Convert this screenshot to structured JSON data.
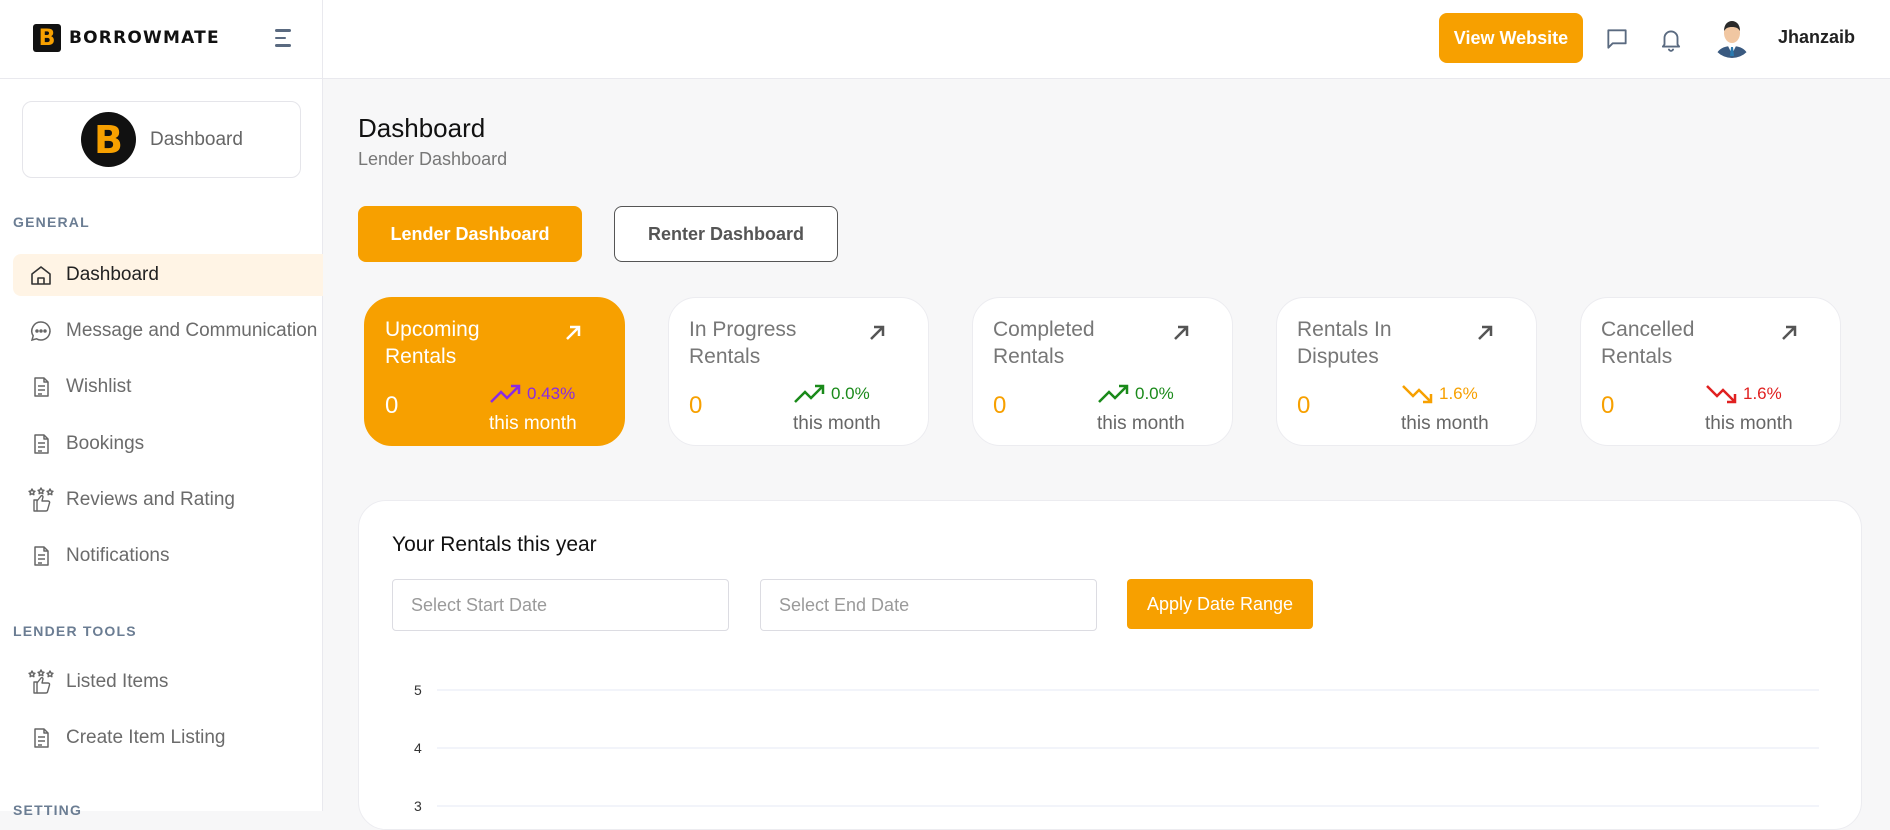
{
  "brand": {
    "name": "BORROWMATE",
    "mark": "B"
  },
  "header": {
    "view_website": "View Website",
    "username": "Jhanzaib",
    "icons": [
      "chat-icon",
      "bell-icon"
    ]
  },
  "sidebar": {
    "profile_label": "Dashboard",
    "sections": [
      {
        "label": "GENERAL"
      },
      {
        "label": "LENDER TOOLS"
      },
      {
        "label": "SETTING"
      }
    ],
    "items": [
      {
        "label": "Dashboard",
        "icon": "home-icon",
        "active": true
      },
      {
        "label": "Message and Communication",
        "icon": "chat-bubble-icon"
      },
      {
        "label": "Wishlist",
        "icon": "document-icon"
      },
      {
        "label": "Bookings",
        "icon": "document-icon"
      },
      {
        "label": "Reviews and Rating",
        "icon": "thumbs-up-stars-icon"
      },
      {
        "label": "Notifications",
        "icon": "document-icon"
      },
      {
        "label": "Listed Items",
        "icon": "thumbs-up-stars-icon"
      },
      {
        "label": "Create Item Listing",
        "icon": "document-icon"
      }
    ]
  },
  "main": {
    "title": "Dashboard",
    "subtitle": "Lender Dashboard",
    "tabs": [
      {
        "label": "Lender Dashboard",
        "active": true
      },
      {
        "label": "Renter Dashboard",
        "active": false
      }
    ],
    "stats": [
      {
        "title": "Upcoming Rentals",
        "value": "0",
        "pct": "0.43%",
        "trend": "up",
        "trend_color": "#8a2be2",
        "period": "this month"
      },
      {
        "title": "In Progress Rentals",
        "value": "0",
        "pct": "0.0%",
        "trend": "up",
        "trend_color": "#1a8a1a",
        "period": "this month"
      },
      {
        "title": "Completed Rentals",
        "value": "0",
        "pct": "0.0%",
        "trend": "up",
        "trend_color": "#1a8a1a",
        "period": "this month"
      },
      {
        "title": "Rentals In Disputes",
        "value": "0",
        "pct": "1.6%",
        "trend": "down",
        "trend_color": "#f7a000",
        "period": "this month"
      },
      {
        "title": "Cancelled Rentals",
        "value": "0",
        "pct": "1.6%",
        "trend": "down",
        "trend_color": "#e02020",
        "period": "this month"
      }
    ],
    "panel": {
      "title": "Your Rentals this year",
      "start_placeholder": "Select Start Date",
      "end_placeholder": "Select End Date",
      "apply_label": "Apply Date Range"
    }
  },
  "colors": {
    "accent": "#f7a000",
    "active_bg": "#fff4e5"
  },
  "chart_data": {
    "type": "line",
    "title": "",
    "y_ticks": [
      "5",
      "4",
      "3"
    ],
    "series": []
  }
}
